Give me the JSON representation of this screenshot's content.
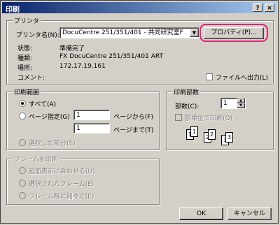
{
  "window": {
    "title": "印刷",
    "help_btn": "?",
    "close_btn": "×"
  },
  "printer": {
    "group_title": "プリンタ",
    "name_label": "プリンタ名(N):",
    "name_value": "DocuCentre 251/351/401 - 共同研究室F",
    "properties_label": "プロパティ(P)...",
    "status_label": "状態:",
    "status_value": "準備完了",
    "type_label": "種類:",
    "type_value": "FX DocuCentre 251/351/401 ART",
    "location_label": "場所:",
    "location_value": "172.17.19.161",
    "comment_label": "コメント:",
    "print_to_file_label": "ファイルへ出力(L)",
    "dropdown_arrow": "▼"
  },
  "range": {
    "group_title": "印刷範囲",
    "all_label": "すべて(A)",
    "pages_label": "ページ指定(G)",
    "from_value": "1",
    "from_label": "ページから(F)",
    "to_value": "1",
    "to_label": "ページまで(T)",
    "selection_label": "選択した部分(S)"
  },
  "copies": {
    "group_title": "印刷部数",
    "count_label": "部数(C):",
    "count_value": "1",
    "collate_label": "部単位で印刷(O)",
    "collate_pages": [
      "1",
      "1",
      "2",
      "2",
      "3",
      "3"
    ]
  },
  "frames": {
    "group_title": "フレームを印刷",
    "opt1": "画面表示に合わせる(U)",
    "opt2": "選択されたフレーム(E)",
    "opt3": "フレーム毎に別々に(E)"
  },
  "buttons": {
    "ok": "OK",
    "cancel": "キャンセル"
  },
  "colors": {
    "highlight": "#e0207a",
    "title_bar": "#0a246a"
  }
}
